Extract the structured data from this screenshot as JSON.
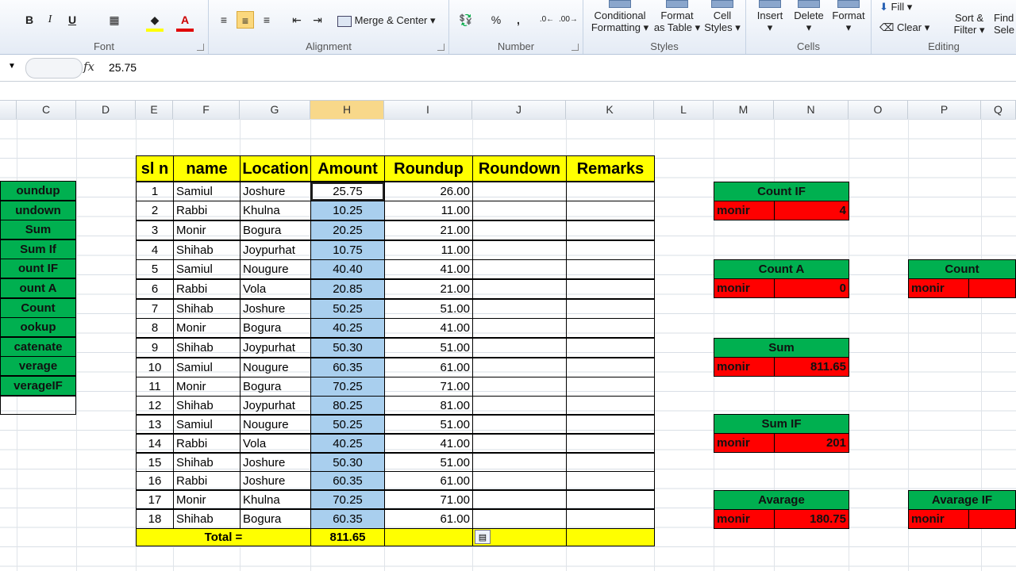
{
  "ribbon": {
    "font_group": "Font",
    "alignment_group": "Alignment",
    "merge_center": "Merge & Center",
    "number_group": "Number",
    "percent": "%",
    "comma": ",",
    "styles_group": "Styles",
    "conditional_formatting": [
      "Conditional",
      "Formatting"
    ],
    "format_as_table": [
      "Format",
      "as Table"
    ],
    "cell_styles": [
      "Cell",
      "Styles"
    ],
    "cells_group": "Cells",
    "insert": "Insert",
    "delete": "Delete",
    "format": "Format",
    "editing_group": "Editing",
    "fill": "Fill",
    "clear": "Clear",
    "sort_filter": [
      "Sort &",
      "Filter"
    ],
    "find_select": [
      "Find",
      "Sele"
    ],
    "bold": "B",
    "italic": "I",
    "underline": "U",
    "font_color_letter": "A"
  },
  "formula_bar": {
    "fx": "fx",
    "value": "25.75"
  },
  "columns": [
    "C",
    "D",
    "E",
    "F",
    "G",
    "H",
    "I",
    "J",
    "K",
    "L",
    "M",
    "N",
    "O",
    "P",
    "Q"
  ],
  "selected_column": "H",
  "left_list": [
    "oundup",
    "undown",
    "Sum",
    "Sum If",
    "ount IF",
    "ount A",
    "Count",
    "ookup",
    "catenate",
    "verage",
    "verageIF"
  ],
  "table": {
    "headers": [
      "sl n",
      "name",
      "Location",
      "Amount",
      "Roundup",
      "Roundown",
      "Remarks"
    ],
    "rows": [
      [
        "1",
        "Samiul",
        "Joshure",
        "25.75",
        "26.00"
      ],
      [
        "2",
        "Rabbi",
        "Khulna",
        "10.25",
        "11.00"
      ],
      [
        "3",
        "Monir",
        "Bogura",
        "20.25",
        "21.00"
      ],
      [
        "4",
        "Shihab",
        "Joypurhat",
        "10.75",
        "11.00"
      ],
      [
        "5",
        "Samiul",
        "Nougure",
        "40.40",
        "41.00"
      ],
      [
        "6",
        "Rabbi",
        "Vola",
        "20.85",
        "21.00"
      ],
      [
        "7",
        "Shihab",
        "Joshure",
        "50.25",
        "51.00"
      ],
      [
        "8",
        "Monir",
        "Bogura",
        "40.25",
        "41.00"
      ],
      [
        "9",
        "Shihab",
        "Joypurhat",
        "50.30",
        "51.00"
      ],
      [
        "10",
        "Samiul",
        "Nougure",
        "60.35",
        "61.00"
      ],
      [
        "11",
        "Monir",
        "Bogura",
        "70.25",
        "71.00"
      ],
      [
        "12",
        "Shihab",
        "Joypurhat",
        "80.25",
        "81.00"
      ],
      [
        "13",
        "Samiul",
        "Nougure",
        "50.25",
        "51.00"
      ],
      [
        "14",
        "Rabbi",
        "Vola",
        "40.25",
        "41.00"
      ],
      [
        "15",
        "Shihab",
        "Joshure",
        "50.30",
        "51.00"
      ],
      [
        "16",
        "Rabbi",
        "Joshure",
        "60.35",
        "61.00"
      ],
      [
        "17",
        "Monir",
        "Khulna",
        "70.25",
        "71.00"
      ],
      [
        "18",
        "Shihab",
        "Bogura",
        "60.35",
        "61.00"
      ]
    ],
    "total_label": "Total =",
    "total_value": "811.65"
  },
  "summary_boxes": [
    {
      "title": "Count IF",
      "key": "monir",
      "value": "4"
    },
    {
      "title": "Count A",
      "key": "monir",
      "value": "0"
    },
    {
      "title": "Sum",
      "key": "monir",
      "value": "811.65"
    },
    {
      "title": "Sum IF",
      "key": "monir",
      "value": "201"
    },
    {
      "title": "Avarage",
      "key": "monir",
      "value": "180.75"
    },
    {
      "title": "Count",
      "key": "monir",
      "value": ""
    },
    {
      "title": "Avarage IF",
      "key": "monir",
      "value": ""
    }
  ],
  "colors": {
    "header_yellow": "#ffff00",
    "green": "#00b050",
    "red": "#ff0000",
    "selection_blue": "#a9cfee"
  }
}
